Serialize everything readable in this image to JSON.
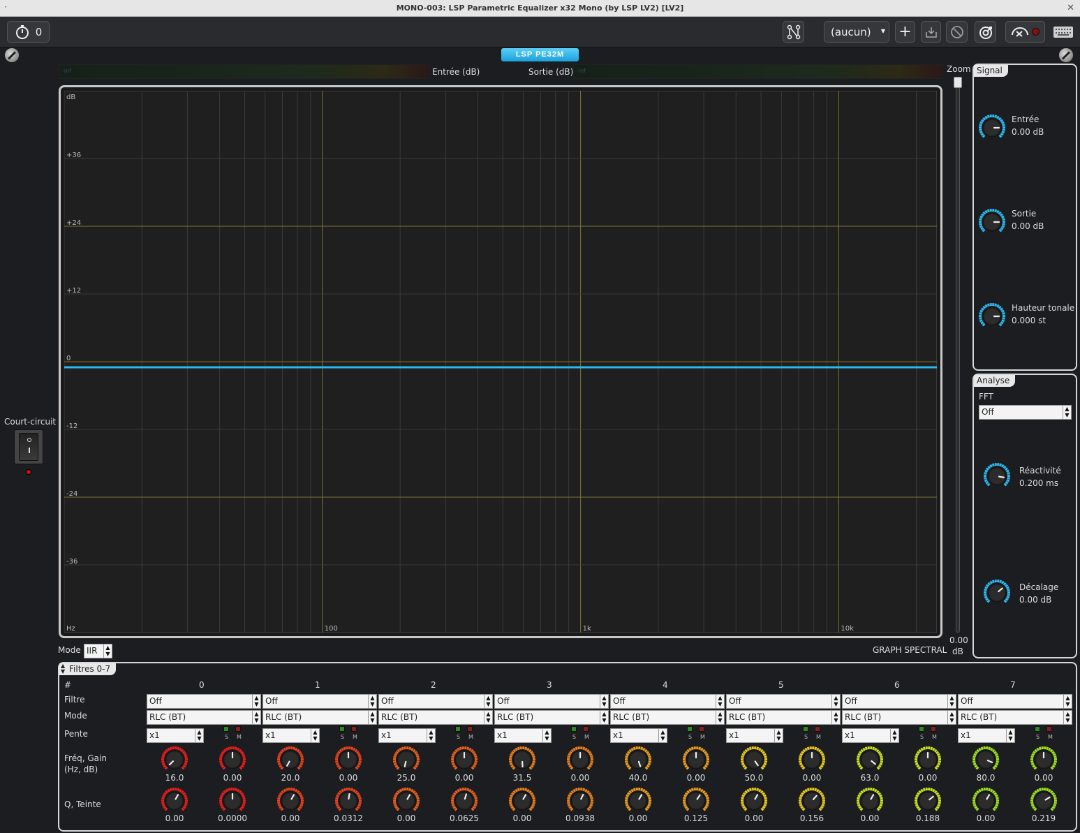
{
  "window": {
    "title": "MONO-003: LSP Parametric Equalizer x32 Mono (by LSP LV2) [LV2]",
    "close": "✕"
  },
  "toolbar": {
    "counter": "0",
    "preset": "(aucun)"
  },
  "plugin": {
    "logo": "LSP PE32M",
    "meter_in_label": "Entrée (dB)",
    "meter_out_label": "Sortie (dB)",
    "meter_in_value": "-inf",
    "meter_out_value": "-inf",
    "zoom_label": "Zoom",
    "zoom_value": "0.00",
    "zoom_unit": "dB",
    "bypass_label": "Court-circuit",
    "mode_label": "Mode",
    "mode_value": "IIR",
    "graph_caption": "GRAPH SPECTRAL",
    "graph": {
      "y_ticks": [
        "dB",
        "+36",
        "+24",
        "+12",
        "0",
        "-12",
        "-24",
        "-36"
      ],
      "x_ticks": [
        "Hz",
        "100",
        "1k",
        "10k"
      ],
      "curve_db": 0,
      "curve_color": "#2ab8f0",
      "grid_major_color": "#7a7530",
      "grid_minor_color": "#3a3a3a"
    }
  },
  "signal": {
    "tab": "Signal",
    "knobs": [
      {
        "label": "Entrée",
        "value": "0.00 dB"
      },
      {
        "label": "Sortie",
        "value": "0.00 dB"
      },
      {
        "label": "Hauteur tonale",
        "value": "0.000 st"
      }
    ]
  },
  "analysis": {
    "tab": "Analyse",
    "fft_label": "FFT",
    "fft_value": "Off",
    "knobs": [
      {
        "label": "Réactivité",
        "value": "0.200 ms"
      },
      {
        "label": "Décalage",
        "value": "0.00 dB"
      }
    ]
  },
  "filters": {
    "tab": "Filtres 0-7",
    "row_labels": {
      "index": "#",
      "filter": "Filtre",
      "mode": "Mode",
      "slope": "Pente",
      "freq_gain_1": "Fréq, Gain",
      "freq_gain_2": "(Hz, dB)",
      "q_hue": "Q, Teinte"
    },
    "solo": "S",
    "mute": "M",
    "bands": [
      {
        "id": "0",
        "filter": "Off",
        "mode": "RLC (BT)",
        "slope": "x1",
        "freq": "16.0",
        "gain": "0.00",
        "q": "0.00",
        "hue": "0.0000",
        "color": "#e81c1c"
      },
      {
        "id": "1",
        "filter": "Off",
        "mode": "RLC (BT)",
        "slope": "x1",
        "freq": "20.0",
        "gain": "0.00",
        "q": "0.00",
        "hue": "0.0312",
        "color": "#e8401c"
      },
      {
        "id": "2",
        "filter": "Off",
        "mode": "RLC (BT)",
        "slope": "x1",
        "freq": "25.0",
        "gain": "0.00",
        "q": "0.00",
        "hue": "0.0625",
        "color": "#e85e1c"
      },
      {
        "id": "3",
        "filter": "Off",
        "mode": "RLC (BT)",
        "slope": "x1",
        "freq": "31.5",
        "gain": "0.00",
        "q": "0.00",
        "hue": "0.0938",
        "color": "#e87e1c"
      },
      {
        "id": "4",
        "filter": "Off",
        "mode": "RLC (BT)",
        "slope": "x1",
        "freq": "40.0",
        "gain": "0.00",
        "q": "0.00",
        "hue": "0.125",
        "color": "#e89c1c"
      },
      {
        "id": "5",
        "filter": "Off",
        "mode": "RLC (BT)",
        "slope": "x1",
        "freq": "50.0",
        "gain": "0.00",
        "q": "0.00",
        "hue": "0.156",
        "color": "#e8c81c"
      },
      {
        "id": "6",
        "filter": "Off",
        "mode": "RLC (BT)",
        "slope": "x1",
        "freq": "63.0",
        "gain": "0.00",
        "q": "0.00",
        "hue": "0.188",
        "color": "#c8e01c"
      },
      {
        "id": "7",
        "filter": "Off",
        "mode": "RLC (BT)",
        "slope": "x1",
        "freq": "80.0",
        "gain": "0.00",
        "q": "0.00",
        "hue": "0.219",
        "color": "#9ce01c"
      }
    ]
  },
  "colors": {
    "accent": "#2ab8f0",
    "panel_border": "#d8d8d8",
    "bg": "#1d1e21"
  }
}
